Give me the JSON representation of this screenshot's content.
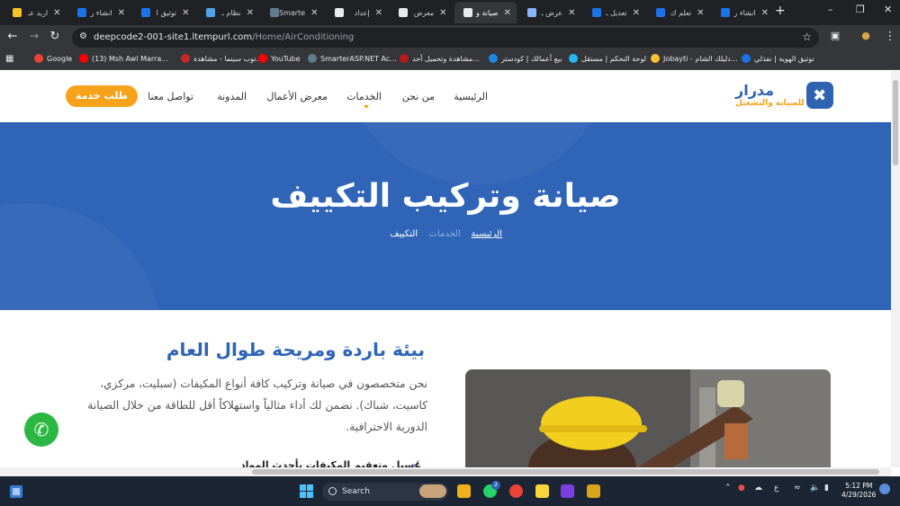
{
  "browser": {
    "tabs": [
      {
        "title": "اريد عـ",
        "color": "#f7c325"
      },
      {
        "title": "انشاء ر",
        "color": "#1a73e8"
      },
      {
        "title": "توثيق ا",
        "color": "#1a73e8"
      },
      {
        "title": "نظام ـ",
        "color": "#4fa3e8"
      },
      {
        "title": "Smarte",
        "color": "#607d8b"
      },
      {
        "title": "إعداد",
        "color": "#e8eaed"
      },
      {
        "title": "معرض",
        "color": "#e8eaed"
      },
      {
        "title": "صيانة و",
        "color": "#e8eaed",
        "active": true
      },
      {
        "title": "عرض ـ",
        "color": "#8ab4f8"
      },
      {
        "title": "تعديل ـ",
        "color": "#1a73e8"
      },
      {
        "title": "تعلم ك",
        "color": "#1a73e8"
      },
      {
        "title": "انشاء ر",
        "color": "#1a73e8"
      }
    ],
    "new_tab": "+",
    "url_host": "deepcode2-001-site1.ltempurl.com",
    "url_path": "/Home/AirConditioning",
    "bookmarks": [
      {
        "label": "Google",
        "color": "#ea4335"
      },
      {
        "label": "(13) Msh Awl Marra...",
        "color": "#ff0000"
      },
      {
        "label": "توب سينما - مشاهدة...",
        "color": "#c62828"
      },
      {
        "label": "YouTube",
        "color": "#ff0000"
      },
      {
        "label": "SmarterASP.NET Ac...",
        "color": "#607d8b"
      },
      {
        "label": "مشاهدة وتحميل أحد...",
        "color": "#b71c1c"
      },
      {
        "label": "بيع أعمالك | كودستر",
        "color": "#1e88e5"
      },
      {
        "label": "لوحة التحكم | مستقل",
        "color": "#29b6f6"
      },
      {
        "label": "Jobayti - دليلك الشام...",
        "color": "#fbc02d"
      },
      {
        "label": "توثيق الهوية | نفذلي",
        "color": "#1a73e8"
      }
    ]
  },
  "site": {
    "logo_name": "مدرار",
    "logo_tag": "للصيانة والتشغيل",
    "nav": [
      "الرئيسية",
      "من نحن",
      "الخدمات",
      "معرض الأعمال",
      "المدونة",
      "تواصل معنا"
    ],
    "cta": "طلب خدمة",
    "hero_title": "صيانة وتركيب التكييف",
    "breadcrumb": [
      "الرئيسية",
      "الخدمات",
      "التكييف"
    ],
    "section_title": "بيئة باردة ومريحة طوال العام",
    "section_body": "نحن متخصصون في صيانة وتركيب كافة أنواع المكيفات (سبليت، مركزي، كاسيت، شباك). نضمن لك أداء مثالياً واستهلاكاً أقل للطاقة من خلال الصيانة الدورية الاحترافية.",
    "feature": "غسيل وتعقيم المكيفات بأحدث المواد"
  },
  "taskbar": {
    "search": "Search",
    "lang": "ع",
    "time": "5:12 PM",
    "date": "4/29/2026",
    "badge": "2"
  },
  "colors": {
    "brand_blue": "#2f64b7",
    "brand_orange": "#f7a21b",
    "whatsapp": "#2bb741"
  }
}
